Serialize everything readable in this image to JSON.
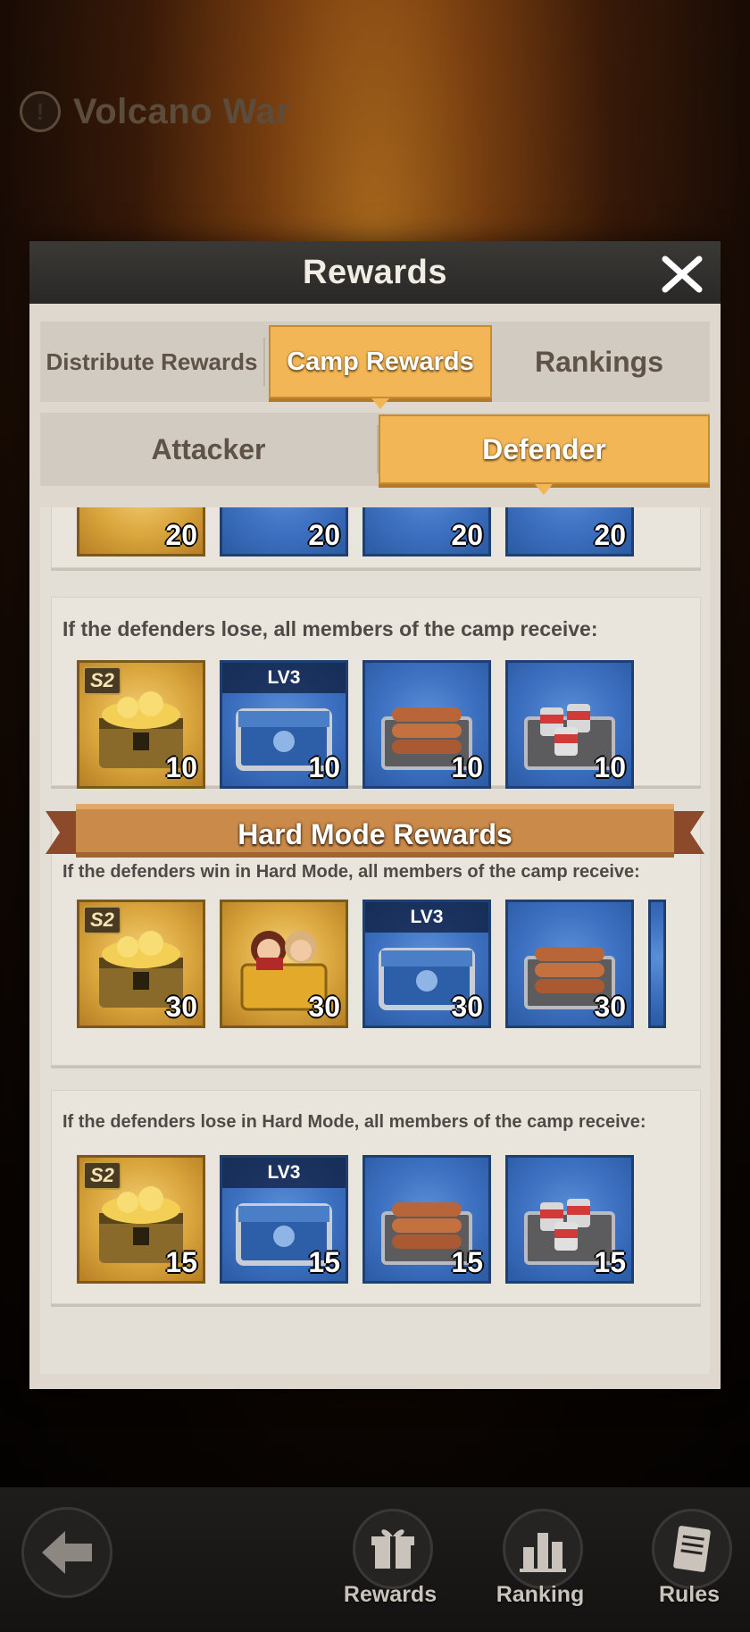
{
  "page": {
    "title": "Volcano War",
    "title_icon": "alert-icon"
  },
  "dialog": {
    "title": "Rewards"
  },
  "tabs": [
    {
      "label": "Distribute Rewards"
    },
    {
      "label": "Camp Rewards",
      "active": true
    },
    {
      "label": "Rankings"
    }
  ],
  "subtabs": [
    {
      "label": "Attacker"
    },
    {
      "label": "Defender",
      "active": true
    }
  ],
  "sections": {
    "top_partial": {
      "items": [
        {
          "type": "s2-gold-chest",
          "count": "20"
        },
        {
          "type": "blue-chest",
          "count": "20"
        },
        {
          "type": "wood-chest",
          "count": "20"
        },
        {
          "type": "food-chest",
          "count": "20"
        }
      ]
    },
    "defenders_lose": {
      "text": "If the defenders lose, all members of the camp receive:",
      "items": [
        {
          "type": "s2-gold-chest",
          "badge": "S2",
          "count": "10"
        },
        {
          "type": "lv3-blue-chest",
          "badge": "LV3",
          "count": "10"
        },
        {
          "type": "wood-chest",
          "count": "10"
        },
        {
          "type": "food-chest",
          "count": "10"
        }
      ]
    },
    "hard_mode_banner": "Hard Mode Rewards",
    "hard_win": {
      "text": "If the defenders win in Hard Mode, all members of the camp receive:",
      "items": [
        {
          "type": "s2-gold-chest",
          "badge": "S2",
          "count": "30"
        },
        {
          "type": "hero-chest",
          "count": "30"
        },
        {
          "type": "lv3-blue-chest",
          "badge": "LV3",
          "count": "30"
        },
        {
          "type": "wood-chest",
          "count": "30"
        }
      ]
    },
    "hard_lose": {
      "text": "If the defenders lose in Hard Mode, all members of the camp receive:",
      "items": [
        {
          "type": "s2-gold-chest",
          "badge": "S2",
          "count": "15"
        },
        {
          "type": "lv3-blue-chest",
          "badge": "LV3",
          "count": "15"
        },
        {
          "type": "wood-chest",
          "count": "15"
        },
        {
          "type": "food-chest",
          "count": "15"
        }
      ]
    }
  },
  "bottom_nav": {
    "back_icon": "back-arrow-icon",
    "buttons": [
      {
        "label": "Rewards",
        "icon": "gift-icon"
      },
      {
        "label": "Ranking",
        "icon": "bar-chart-icon"
      },
      {
        "label": "Rules",
        "icon": "document-icon"
      }
    ]
  },
  "colors": {
    "accent": "#f2b656",
    "dialog_bg": "#e9e4dc",
    "header_bg": "#2f2d2b",
    "banner": "#c98a4a"
  }
}
